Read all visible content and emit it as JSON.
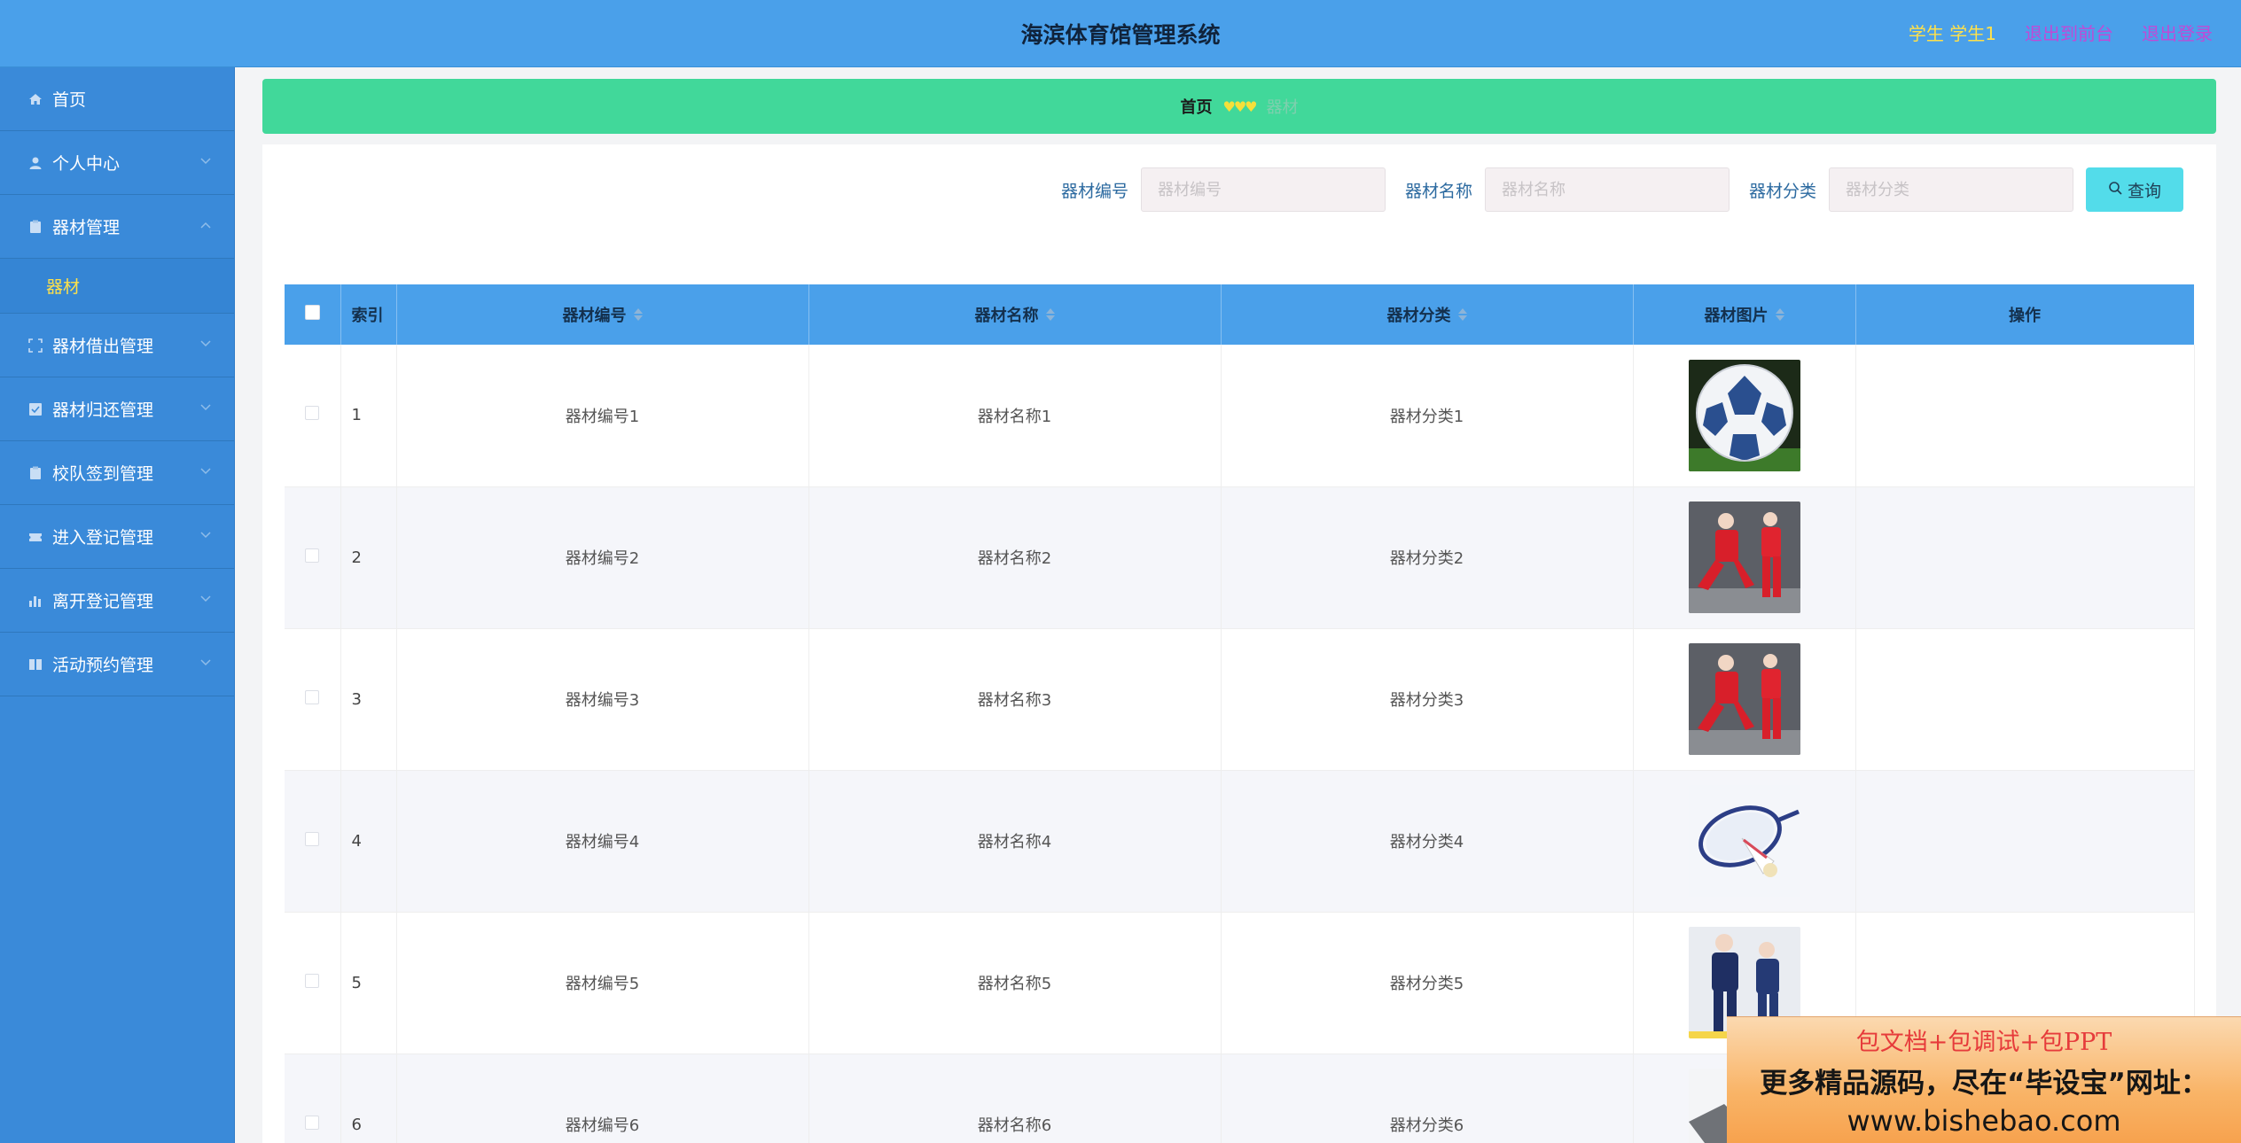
{
  "header": {
    "title": "海滨体育馆管理系统",
    "user": "学生 学生1",
    "to_admin": "退出到前台",
    "logout": "退出登录"
  },
  "sidebar": {
    "items": [
      {
        "label": "首页",
        "icon": "home-icon"
      },
      {
        "label": "个人中心",
        "icon": "user-icon"
      },
      {
        "label": "器材管理",
        "icon": "clipboard-icon",
        "expanded": true,
        "sub": [
          {
            "label": "器材"
          }
        ]
      },
      {
        "label": "器材借出管理",
        "icon": "fullscreen-icon"
      },
      {
        "label": "器材归还管理",
        "icon": "checkbox-icon"
      },
      {
        "label": "校队签到管理",
        "icon": "clipboard-icon"
      },
      {
        "label": "进入登记管理",
        "icon": "ticket-icon"
      },
      {
        "label": "离开登记管理",
        "icon": "bar-chart-icon"
      },
      {
        "label": "活动预约管理",
        "icon": "book-icon"
      }
    ]
  },
  "breadcrumb": {
    "home": "首页",
    "separator": "♥♥♥",
    "current": "器材"
  },
  "search": {
    "code_label": "器材编号",
    "code_placeholder": "器材编号",
    "name_label": "器材名称",
    "name_placeholder": "器材名称",
    "category_label": "器材分类",
    "category_placeholder": "器材分类",
    "button": "查询"
  },
  "table": {
    "headers": {
      "index": "索引",
      "code": "器材编号",
      "name": "器材名称",
      "category": "器材分类",
      "image": "器材图片",
      "actions": "操作"
    },
    "rows": [
      {
        "index": "1",
        "code": "器材编号1",
        "name": "器材名称1",
        "category": "器材分类1",
        "image": "soccer-ball"
      },
      {
        "index": "2",
        "code": "器材编号2",
        "name": "器材名称2",
        "category": "器材分类2",
        "image": "red-tracksuit"
      },
      {
        "index": "3",
        "code": "器材编号3",
        "name": "器材名称3",
        "category": "器材分类3",
        "image": "red-tracksuit"
      },
      {
        "index": "4",
        "code": "器材编号4",
        "name": "器材名称4",
        "category": "器材分类4",
        "image": "badminton"
      },
      {
        "index": "5",
        "code": "器材编号5",
        "name": "器材名称5",
        "category": "器材分类5",
        "image": "navy-tracksuit"
      },
      {
        "index": "6",
        "code": "器材编号6",
        "name": "器材名称6",
        "category": "器材分类6",
        "image": "gray-item"
      }
    ]
  },
  "promo": {
    "line1": "包文档+包调试+包PPT",
    "line2": "更多精品源码，尽在“毕设宝”网址：",
    "line3": "www.bishebao.com"
  }
}
